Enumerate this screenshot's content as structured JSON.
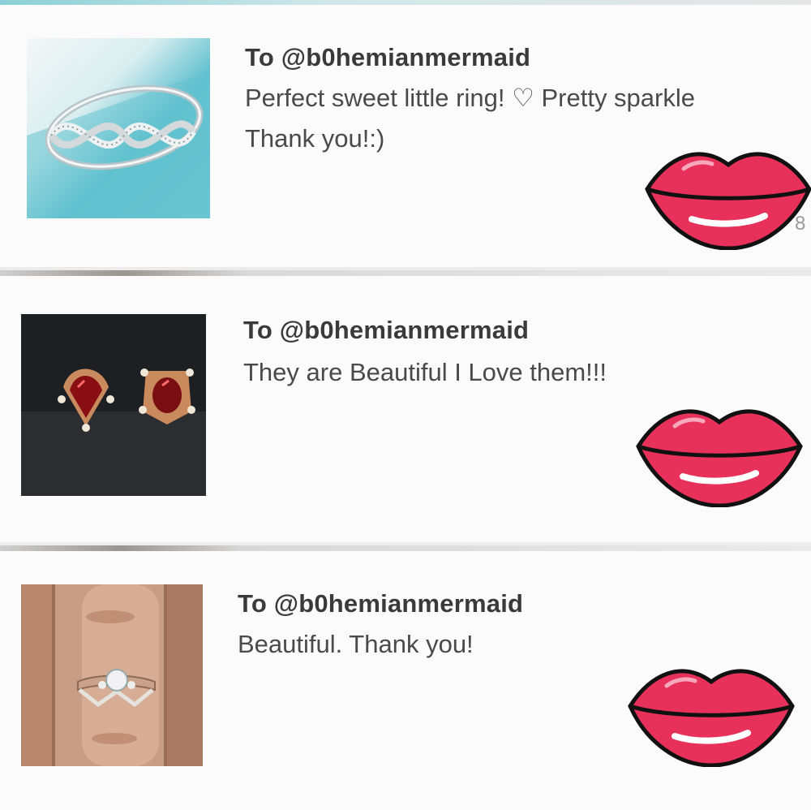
{
  "reviews": [
    {
      "to": "To @b0hemianmermaid",
      "line1": "Perfect sweet little ring! ♡ Pretty sparkle",
      "line2": "Thank you!:)",
      "thumb_icon": "infinity-ring-photo",
      "stray": "8"
    },
    {
      "to": "To @b0hemianmermaid",
      "line1": "They are Beautiful I Love them!!!",
      "line2": "",
      "thumb_icon": "red-earrings-photo",
      "stray": ""
    },
    {
      "to": "To @b0hemianmermaid",
      "line1": "Beautiful. Thank you!",
      "line2": "",
      "thumb_icon": "ring-on-finger-photo",
      "stray": ""
    }
  ],
  "colors": {
    "lips": "#e8315a",
    "lips_dark": "#c01e45",
    "outline": "#111111",
    "teal": "#6cc3d0"
  }
}
